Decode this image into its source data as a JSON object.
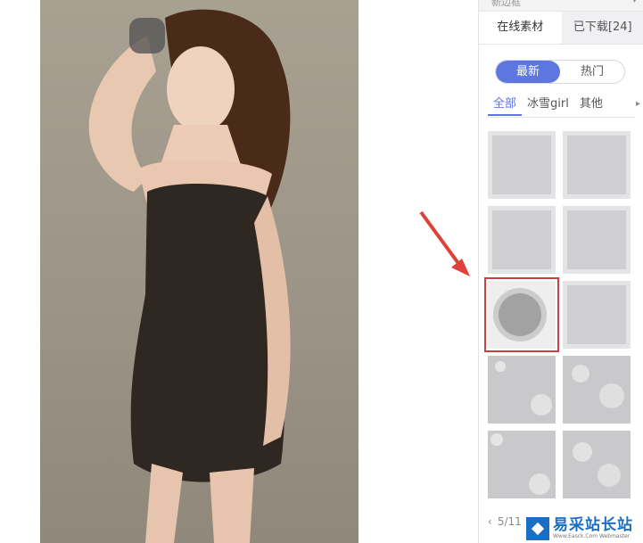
{
  "panel": {
    "header_title": "新边框",
    "tabs": [
      {
        "label": "在线素材"
      },
      {
        "label": "已下载[24]"
      }
    ],
    "sort_toggle": {
      "options": [
        "最新",
        "热门"
      ],
      "selected": "最新"
    },
    "categories": [
      "全部",
      "冰雪girl",
      "其他"
    ],
    "selected_category": "全部",
    "pager": {
      "prev_icon": "chevron-left-icon",
      "page_text": "5/11"
    }
  },
  "watermark": {
    "cn": "易采站长站",
    "en": "Www.Easck.Com Webmaster"
  },
  "colors": {
    "accent": "#5e77e0",
    "highlight": "#c8403f",
    "arrow": "#e0403a"
  }
}
